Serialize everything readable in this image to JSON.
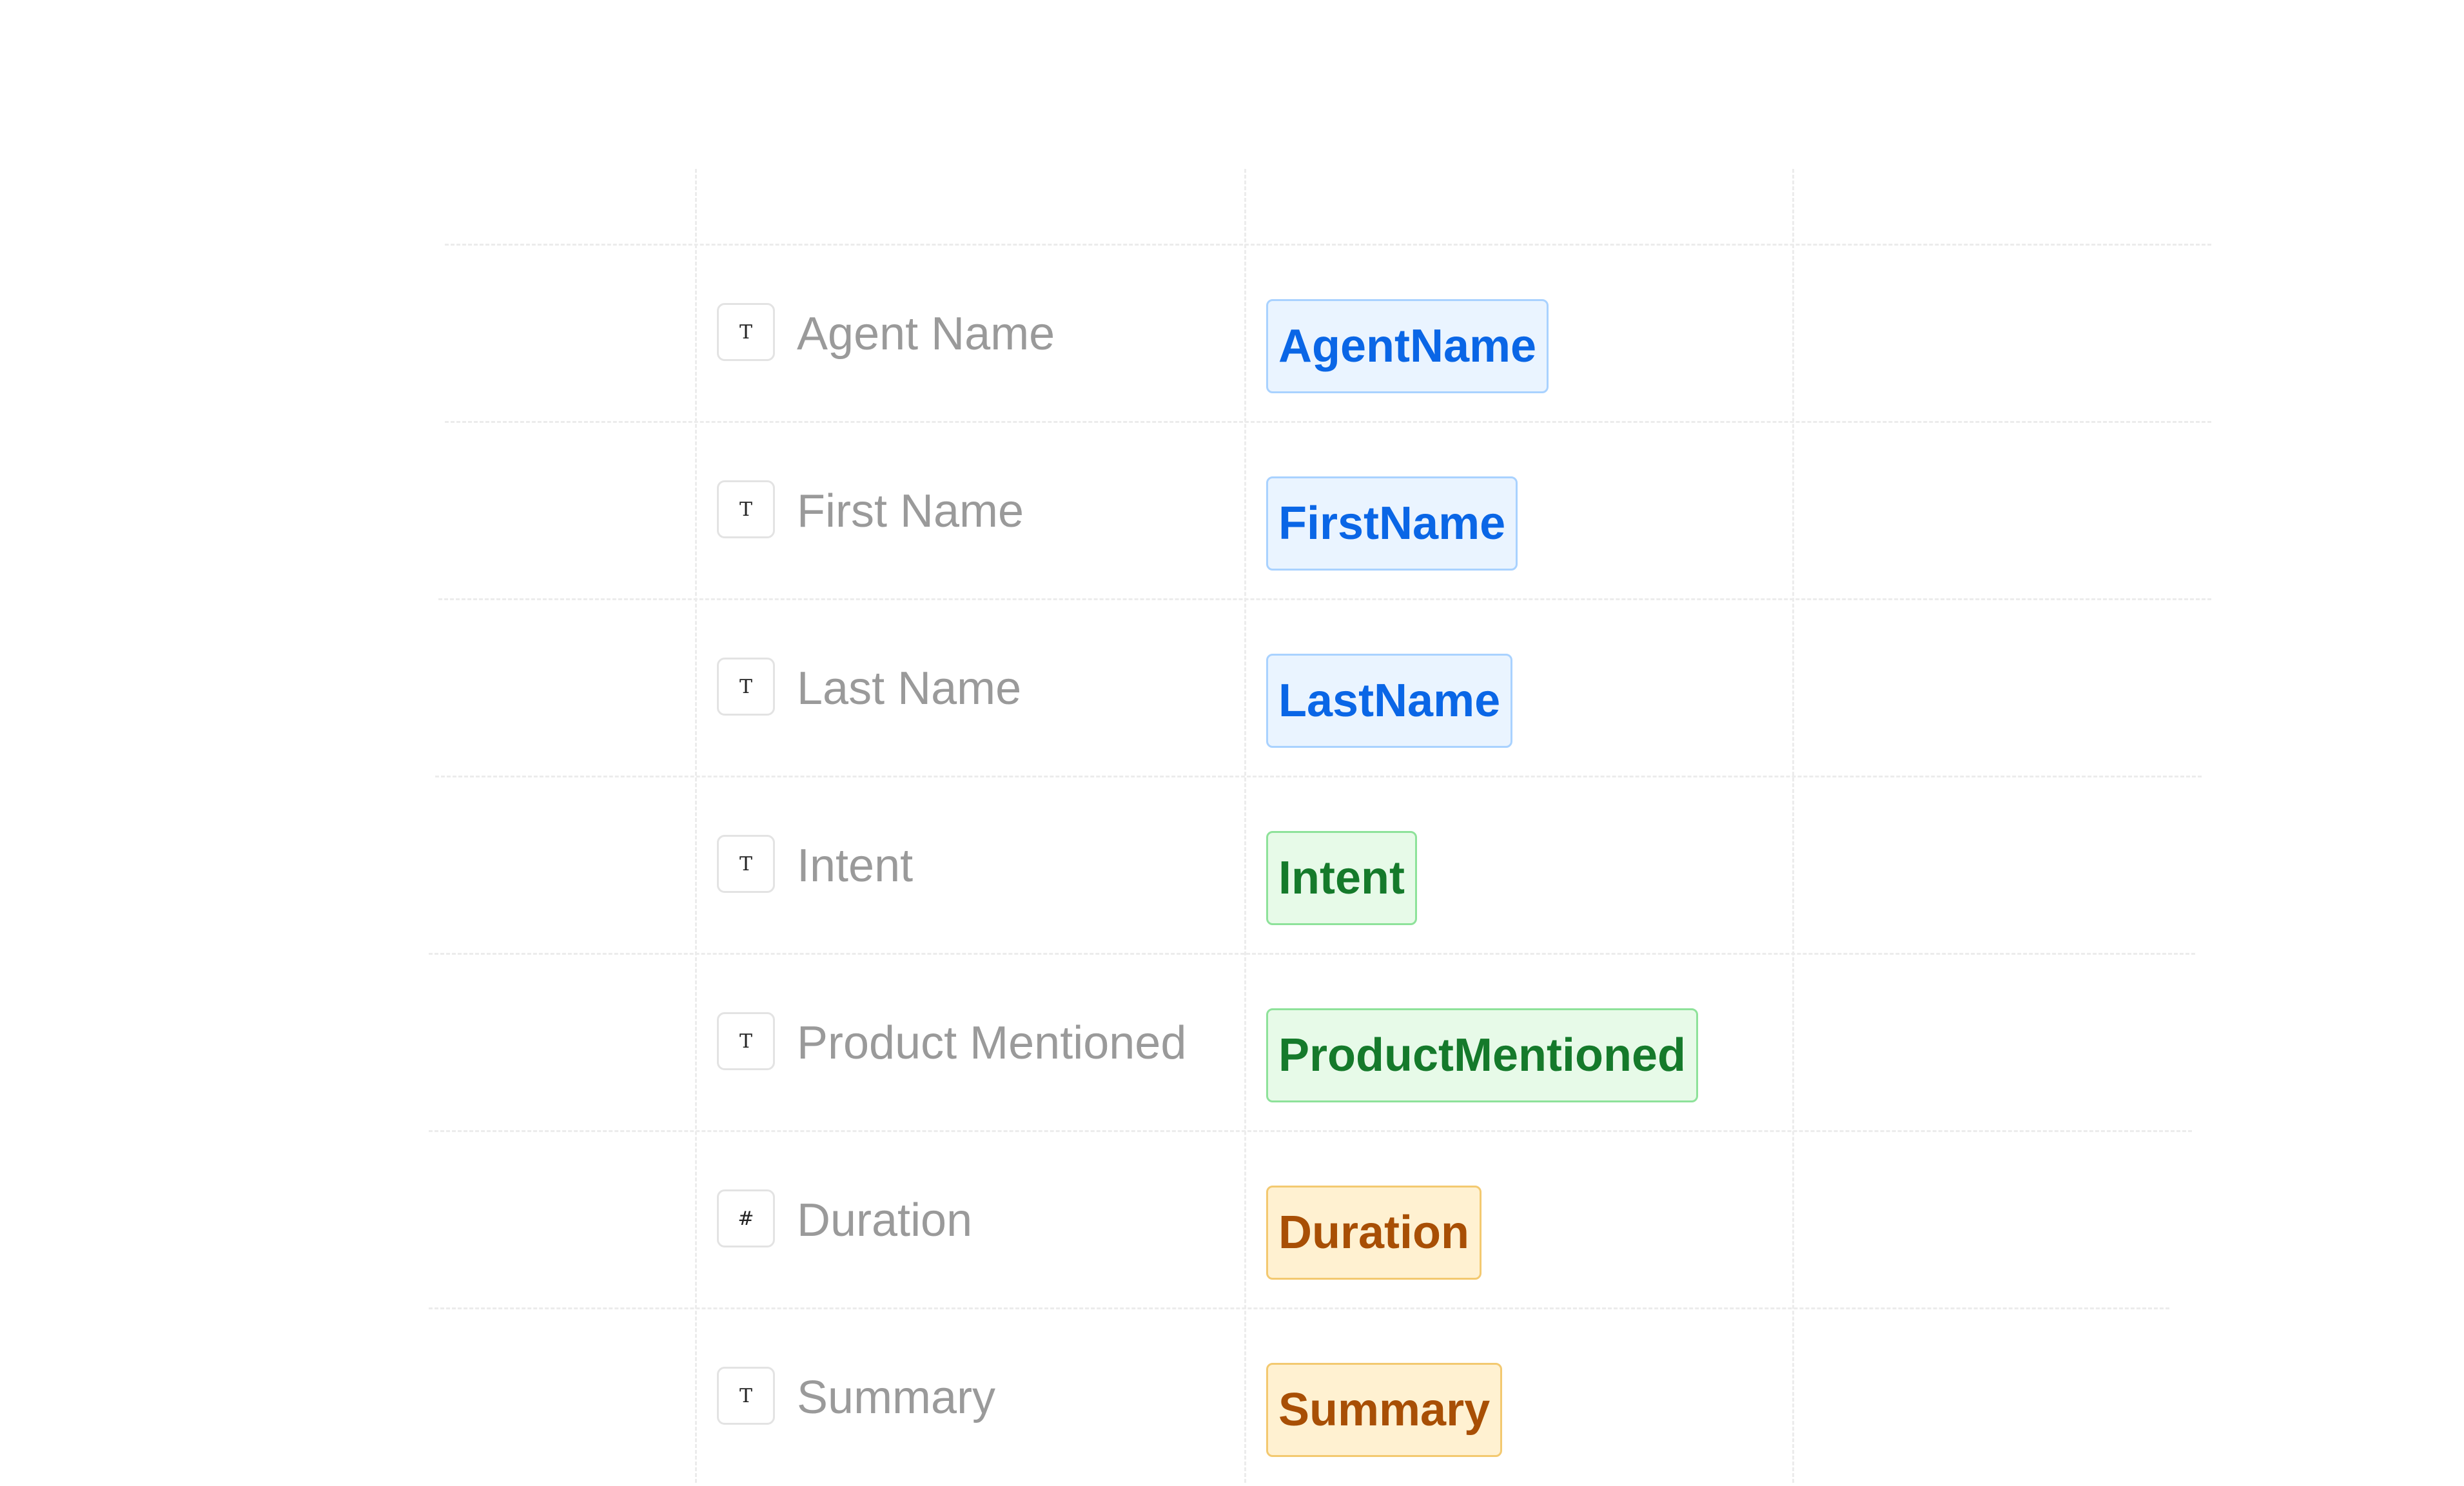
{
  "fields": [
    {
      "type_symbol": "T",
      "label": "Agent Name",
      "variable": "AgentName",
      "variable_color": "blue"
    },
    {
      "type_symbol": "T",
      "label": "First Name",
      "variable": "FirstName",
      "variable_color": "blue"
    },
    {
      "type_symbol": "T",
      "label": "Last Name",
      "variable": "LastName",
      "variable_color": "blue"
    },
    {
      "type_symbol": "T",
      "label": "Intent",
      "variable": "Intent",
      "variable_color": "green"
    },
    {
      "type_symbol": "T",
      "label": "Product Mentioned",
      "variable": "ProductMentioned",
      "variable_color": "green"
    },
    {
      "type_symbol": "#",
      "label": "Duration",
      "variable": "Duration",
      "variable_color": "orange"
    },
    {
      "type_symbol": "T",
      "label": "Summary",
      "variable": "Summary",
      "variable_color": "orange"
    }
  ],
  "colors": {
    "blue": "#0a66e6",
    "green": "#157a2b",
    "orange": "#a84f05",
    "label_gray": "#9a9a9a"
  }
}
